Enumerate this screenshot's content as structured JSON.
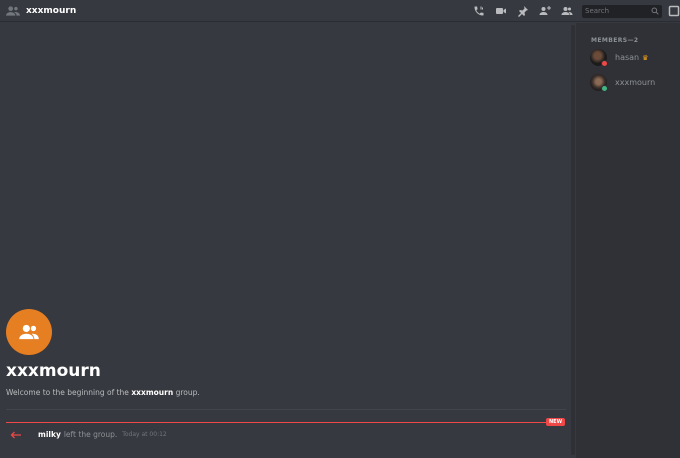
{
  "header": {
    "title": "xxxmourn",
    "search_placeholder": "Search",
    "buttons": [
      "call-icon",
      "video-icon",
      "pin-icon",
      "add-member-icon",
      "members-icon"
    ]
  },
  "members": {
    "header": "MEMBERS—2",
    "list": [
      {
        "name": "hasan",
        "owner": true,
        "status": "dnd",
        "status_color": "#f04747"
      },
      {
        "name": "xxxmourn",
        "owner": false,
        "status": "online",
        "status_color": "#43b581"
      }
    ]
  },
  "intro": {
    "title": "xxxmourn",
    "sub_prefix": "Welcome to the beginning of the",
    "sub_name": "xxxmourn",
    "sub_suffix": "group.",
    "avatar_color": "#e67e22"
  },
  "divider": {
    "new_badge": "NEW"
  },
  "system_message": {
    "user": "milky",
    "action": "left the group.",
    "time": "Today at 00:12"
  },
  "colors": {
    "background": "#36393f",
    "sidebar": "#2f3136",
    "accent_red": "#f04747",
    "online_green": "#43b581",
    "owner_crown": "#faa61a"
  }
}
